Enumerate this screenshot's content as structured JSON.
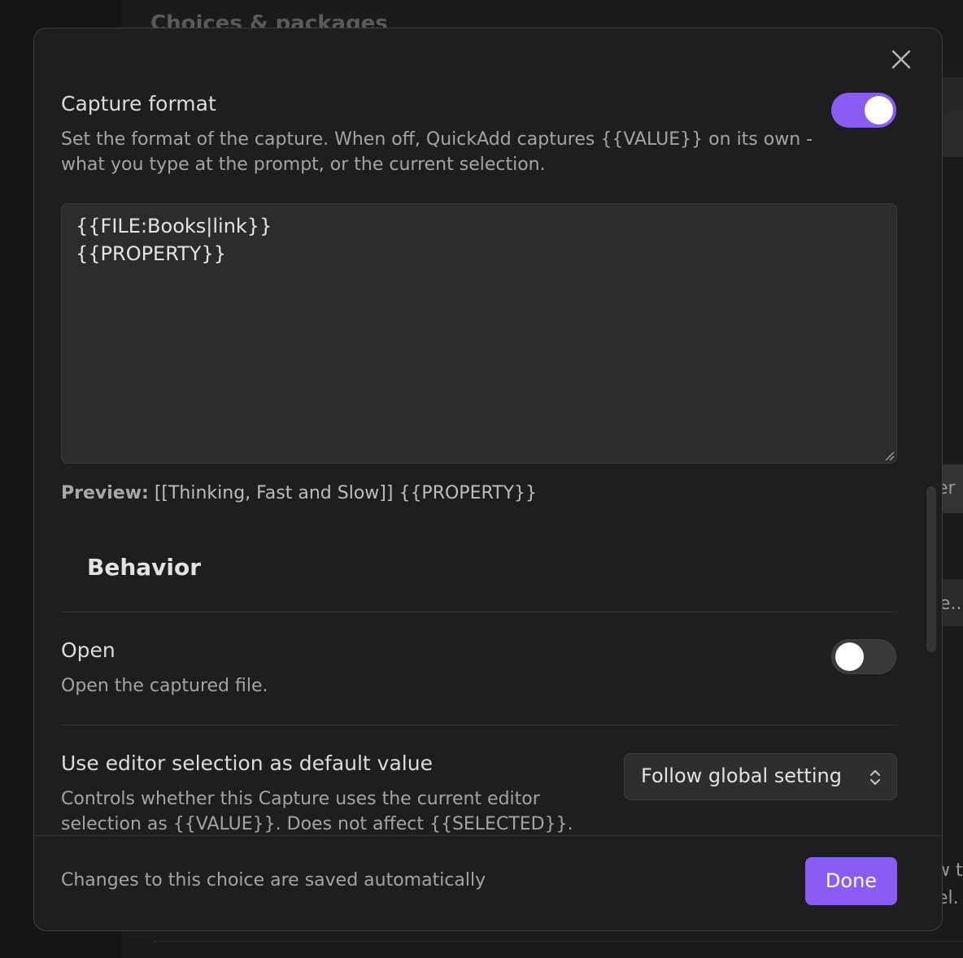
{
  "background": {
    "heading": "Choices & packages",
    "side_fragment_1": "er",
    "side_fragment_2": "e...",
    "side_fragment_3": "w t",
    "side_fragment_4": "el."
  },
  "modal": {
    "close_icon": "close-icon",
    "capture_format": {
      "name": "Capture format",
      "description": "Set the format of the capture. When off, QuickAdd captures {{VALUE}} on its own - what you type at the prompt, or the current selection.",
      "enabled": true,
      "format_text": "{{FILE:Books|link}}\n{{PROPERTY}}",
      "preview_label": "Preview:",
      "preview_value": " [[Thinking, Fast and Slow]] {{PROPERTY}}"
    },
    "behavior": {
      "heading": "Behavior",
      "open": {
        "name": "Open",
        "description": "Open the captured file.",
        "enabled": false
      },
      "editor_selection": {
        "name": "Use editor selection as default value",
        "description": "Controls whether this Capture uses the current editor selection as {{VALUE}}. Does not affect {{SELECTED}}.",
        "selected_option": "Follow global setting"
      }
    },
    "footer": {
      "note": "Changes to this choice are saved automatically",
      "done_label": "Done"
    }
  },
  "colors": {
    "accent": "#8a5cf5",
    "modal_bg": "#1e1e1e",
    "input_bg": "#2c2c2c"
  }
}
